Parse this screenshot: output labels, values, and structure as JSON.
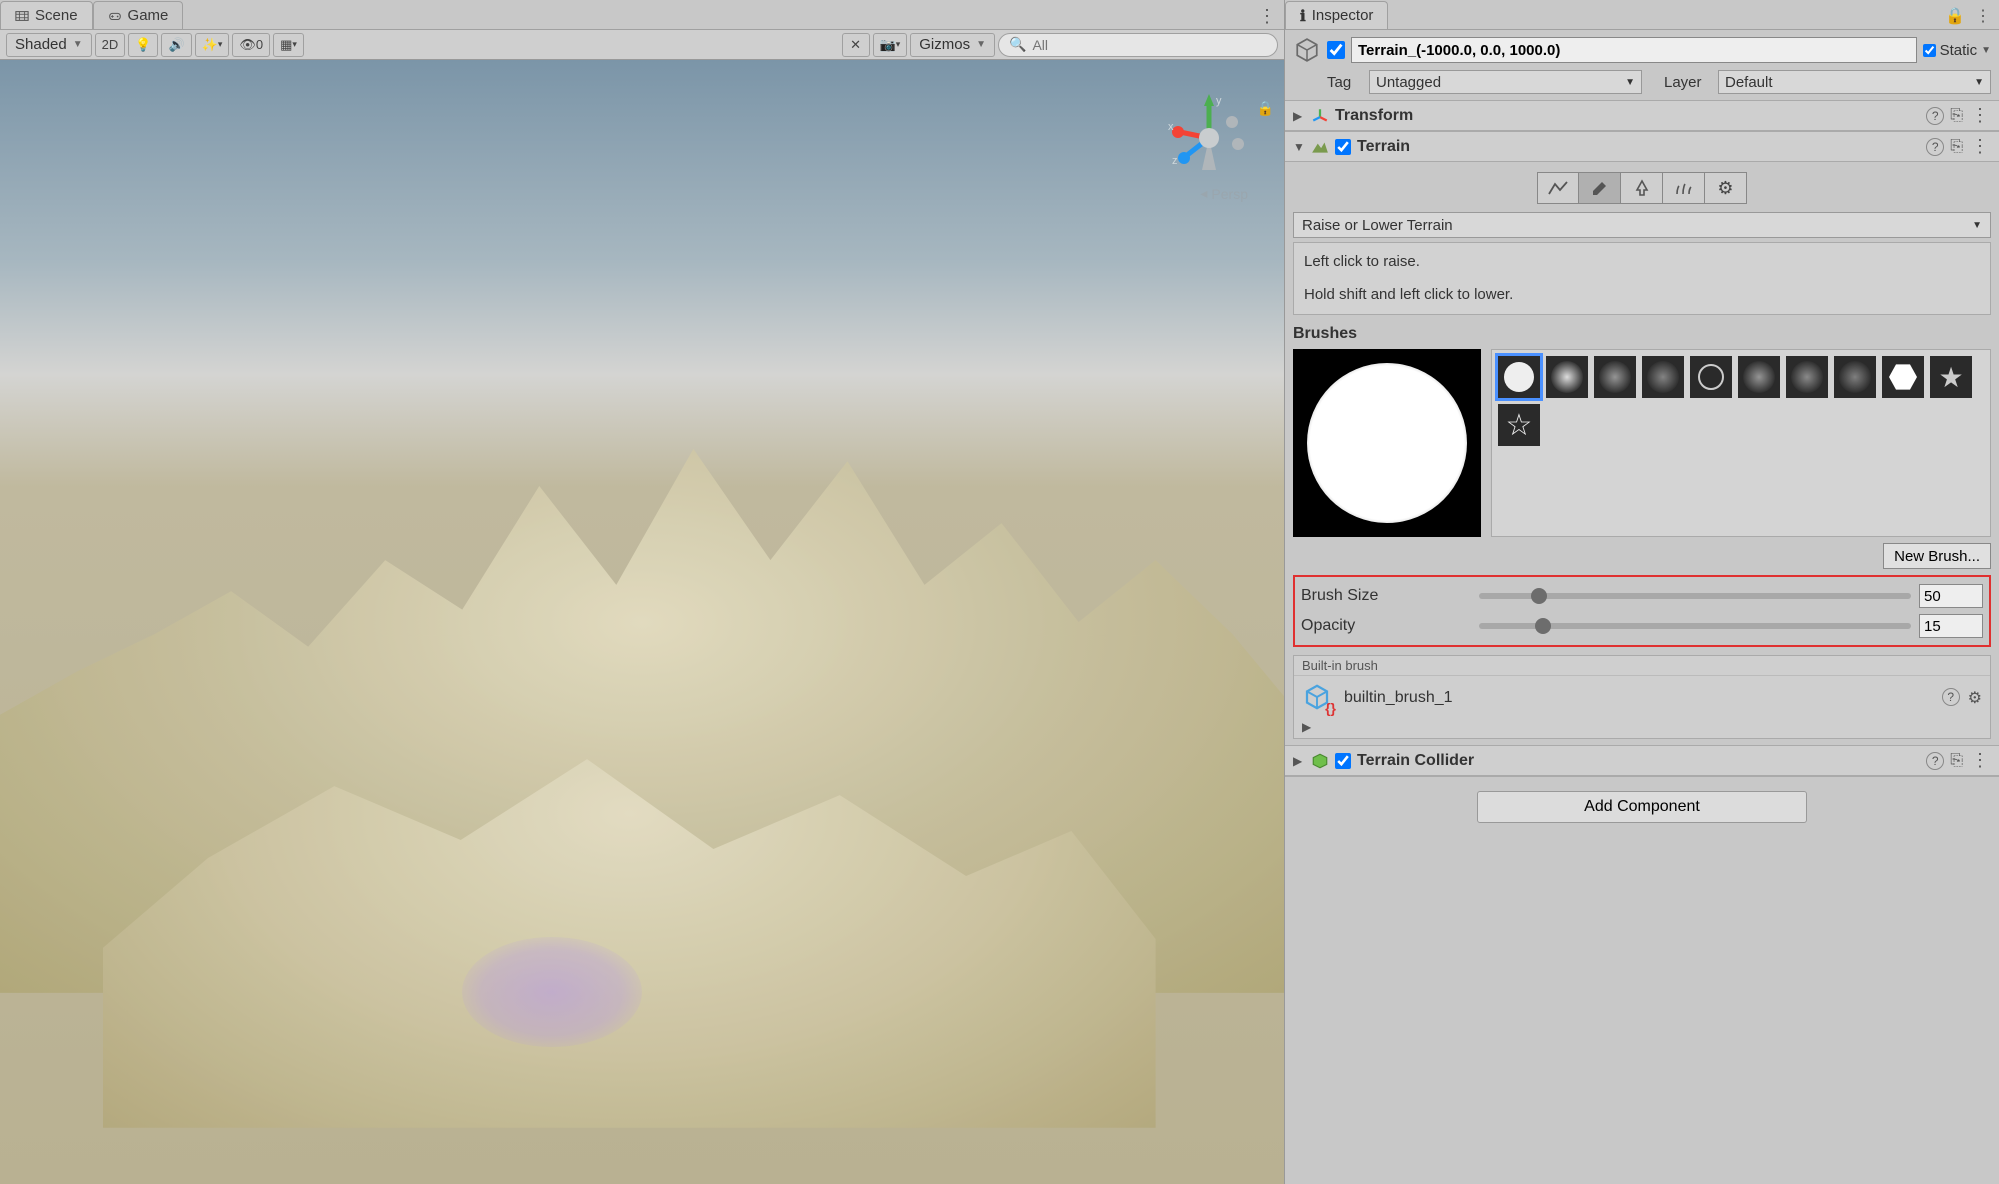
{
  "tabs": {
    "scene": "Scene",
    "game": "Game",
    "inspector": "Inspector"
  },
  "scene_toolbar": {
    "shading": "Shaded",
    "mode2d": "2D",
    "hidden_count": "0",
    "gizmos": "Gizmos",
    "search_placeholder": "All"
  },
  "viewport": {
    "projection": "Persp",
    "axes": {
      "x": "x",
      "y": "y",
      "z": "z"
    }
  },
  "gameobject": {
    "name": "Terrain_(-1000.0, 0.0, 1000.0)",
    "enabled": true,
    "static_label": "Static",
    "tag_label": "Tag",
    "tag_value": "Untagged",
    "layer_label": "Layer",
    "layer_value": "Default"
  },
  "components": {
    "transform": {
      "name": "Transform"
    },
    "terrain": {
      "name": "Terrain",
      "tool_dropdown": "Raise or Lower Terrain",
      "hint_line1": "Left click to raise.",
      "hint_line2": "Hold shift and left click to lower.",
      "brushes_title": "Brushes",
      "new_brush": "New Brush...",
      "brush_size_label": "Brush Size",
      "brush_size_value": "50",
      "opacity_label": "Opacity",
      "opacity_value": "15",
      "builtin_title": "Built-in brush",
      "builtin_asset": "builtin_brush_1"
    },
    "terrain_collider": {
      "name": "Terrain Collider"
    }
  },
  "add_component": "Add Component"
}
